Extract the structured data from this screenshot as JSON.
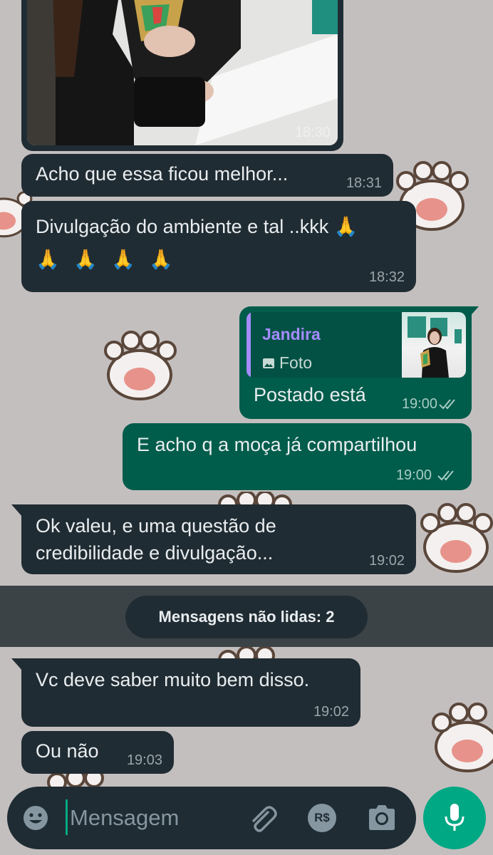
{
  "colors": {
    "wallpaper": "#c4bfbf",
    "incoming_bubble": "#202c33",
    "outgoing_bubble": "#005c4b",
    "accent": "#00a884",
    "quote_name": "#a58bff"
  },
  "messages": [
    {
      "direction": "in",
      "type": "image",
      "time": "18:30"
    },
    {
      "direction": "in",
      "text": "Acho que essa ficou melhor...",
      "time": "18:31"
    },
    {
      "direction": "in",
      "text_line1": "Divulgação do ambiente e tal ..kkk 🙏",
      "text_line2": "🙏 🙏 🙏 🙏",
      "time": "18:32"
    },
    {
      "direction": "out",
      "quote": {
        "name": "Jandira",
        "icon": "photo-icon",
        "label": "Foto"
      },
      "text": "Postado está",
      "time": "19:00",
      "status": "read"
    },
    {
      "direction": "out",
      "text": "E acho q a moça já compartilhou",
      "time": "19:00",
      "status": "read"
    },
    {
      "direction": "in",
      "text_line1": "Ok valeu, e uma questão de",
      "text_line2": "credibilidade e divulgação...",
      "time": "19:02"
    },
    {
      "direction": "in",
      "text": "Vc deve saber muito bem disso.",
      "time": "19:02"
    },
    {
      "direction": "in",
      "text": "Ou não",
      "time": "19:03"
    }
  ],
  "unread_divider": "Mensagens não lidas: 2",
  "composer": {
    "placeholder": "Mensagem",
    "icons": [
      "emoji-icon",
      "attach-icon",
      "payment-icon",
      "camera-icon",
      "mic-icon"
    ],
    "payment_label": "R$"
  }
}
